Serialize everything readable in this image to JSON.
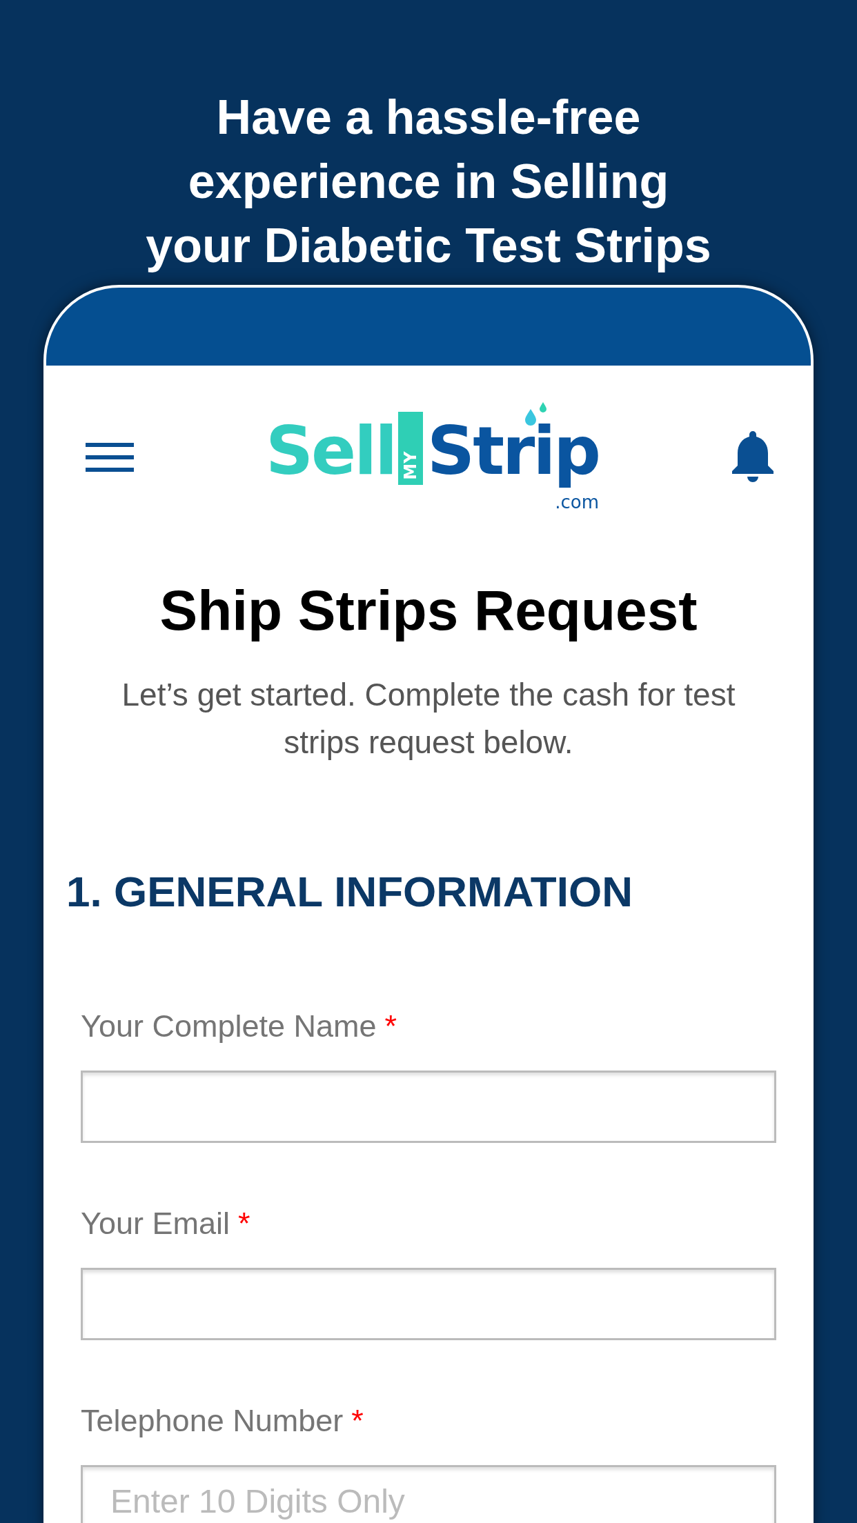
{
  "headline": [
    "Have a hassle-free",
    "experience in Selling",
    "your Diabetic Test Strips"
  ],
  "app_header": {
    "logo": {
      "first": "Sell",
      "badge": "MY",
      "second": "Strip",
      "domain": ".com"
    }
  },
  "page": {
    "title": "Ship Strips Request",
    "subtitle": "Let’s get started. Complete the cash for test strips request below."
  },
  "section": {
    "heading": "1. GENERAL INFORMATION",
    "fields": [
      {
        "label": "Your Complete Name",
        "required": true,
        "marker": "*"
      },
      {
        "label": "Your Email",
        "required": true,
        "marker": "*"
      },
      {
        "label": "Telephone Number",
        "required": true,
        "marker": "*",
        "placeholder": "Enter 10 Digits Only"
      }
    ]
  }
}
